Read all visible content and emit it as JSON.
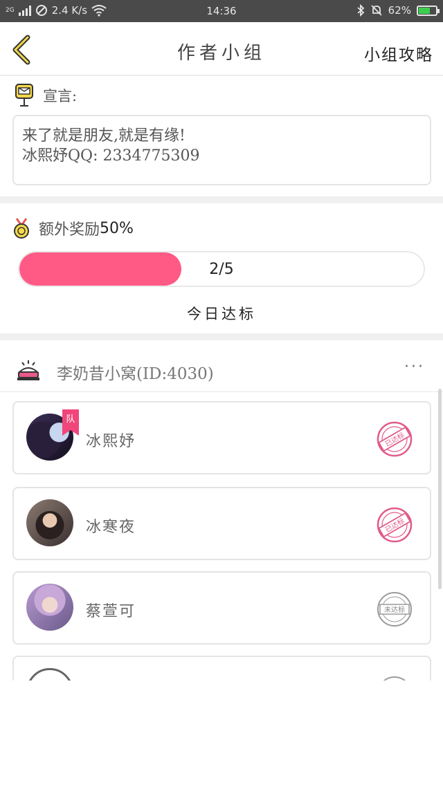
{
  "status_bar": {
    "network": "2G",
    "speed": "2.4 K/s",
    "time": "14:36",
    "battery": "62%"
  },
  "header": {
    "back_icon": "chevron-left-icon",
    "title": "作者小组",
    "right_link": "小组攻略"
  },
  "declaration": {
    "icon": "mailbox-icon",
    "label": "宣言:",
    "line1": "来了就是朋友,就是有缘!",
    "line2": "冰熙妤QQ: 2334775309"
  },
  "reward": {
    "icon": "medal-icon",
    "label": "额外奖励",
    "percent": "50%",
    "progress_text": "2/5",
    "progress_fraction": 0.4,
    "status": "今日达标"
  },
  "group": {
    "icon": "house-icon",
    "name": "李奶昔小窝(ID:4030)",
    "more": "···",
    "members": [
      {
        "name": "冰熙妤",
        "leader": true,
        "leader_badge": "队",
        "stamp_text": "已达标",
        "met": true
      },
      {
        "name": "冰寒夜",
        "leader": false,
        "stamp_text": "已达标",
        "met": true
      },
      {
        "name": "蔡萱可",
        "leader": false,
        "stamp_text": "未达标",
        "met": false
      }
    ]
  },
  "colors": {
    "accent": "#ff5a86",
    "met_stamp": "#e05a8a",
    "unmet_stamp": "#9a9a9a"
  }
}
